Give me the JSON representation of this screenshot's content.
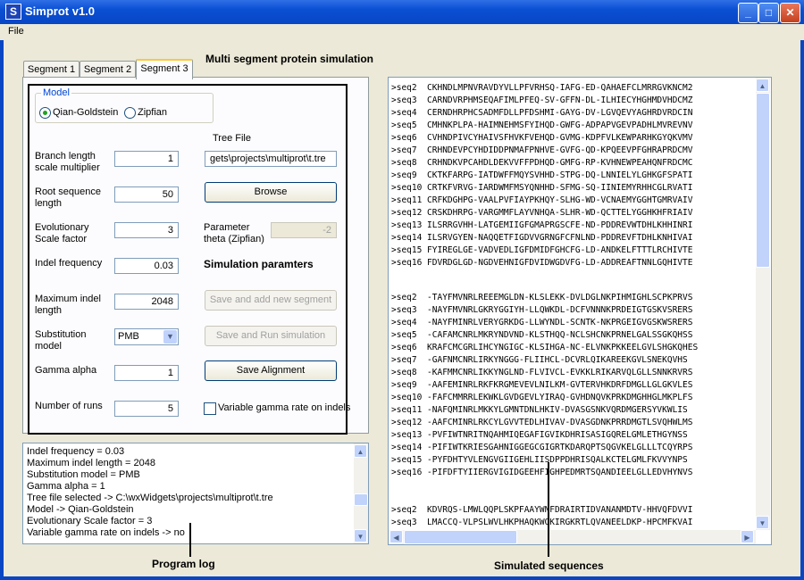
{
  "window": {
    "title": "Simprot v1.0",
    "icon_letter": "S"
  },
  "menu": {
    "file": "File"
  },
  "headings": {
    "main": "Multi segment protein simulation",
    "sim_params": "Simulation paramters",
    "program_log": "Program log",
    "simulated_sequences": "Simulated sequences"
  },
  "tabs": [
    "Segment 1",
    "Segment 2",
    "Segment 3"
  ],
  "model": {
    "legend": "Model",
    "options": [
      "Qian-Goldstein",
      "Zipfian"
    ],
    "selected": "Qian-Goldstein"
  },
  "fields": {
    "branch_length": {
      "label1": "Branch length",
      "label2": "scale multiplier",
      "value": "1"
    },
    "root_seq_length": {
      "label1": "Root sequence",
      "label2": "length",
      "value": "50"
    },
    "evo_scale": {
      "label1": "Evolutionary",
      "label2": "Scale factor",
      "value": "3"
    },
    "indel_freq": {
      "label1": "Indel frequency",
      "value": "0.03"
    },
    "max_indel": {
      "label1": "Maximum indel",
      "label2": "length",
      "value": "2048"
    },
    "substitution": {
      "label1": "Substitution",
      "label2": "model",
      "value": "PMB"
    },
    "gamma_alpha": {
      "label1": "Gamma alpha",
      "value": "1"
    },
    "num_runs": {
      "label1": "Number of runs",
      "value": "5"
    },
    "tree_file": {
      "label": "Tree File",
      "value": "gets\\projects\\multiprot\\t.tre"
    },
    "param_theta": {
      "label1": "Parameter",
      "label2": "theta (Zipfian)",
      "value": "-2"
    }
  },
  "buttons": {
    "browse": "Browse",
    "save_add": "Save and add new segment",
    "save_run": "Save and Run simulation",
    "save_alignment": "Save Alignment"
  },
  "checkbox": {
    "variable_gamma": "Variable gamma rate on indels",
    "checked": false
  },
  "log": [
    "Indel frequency = 0.03",
    "Maximum indel length = 2048",
    "Substitution model = PMB",
    "Gamma alpha = 1",
    "Tree file selected -> C:\\wxWidgets\\projects\\multiprot\\t.tre",
    "Model -> Qian-Goldstein",
    "Evolutionary Scale factor = 3",
    "Variable gamma rate on indels -> no"
  ],
  "sequences": {
    "block1": [
      ">seq2  CKHNDLMPNVRAVDYVLLPFVRHSQ-IAFG-ED-QAHAEFCLMRRGVKNCM2",
      ">seq3  CARNDVRPHMSEQAFIMLPFEQ-SV-GFFN-DL-ILHIECYHGHMDVHDCMZ",
      ">seq4  CERNDHRPHCSADMFDLLPFDSHMI-GAYG-DV-LGVQEVYAGHRDVRDCIN",
      ">seq5  CMHNKPLPA-HAIMNEHMSFYIHQD-GWFG-ADPAPVGEVPADHLMVREVNV",
      ">seq6  CVHNDPIVCYHAIVSFHVKFVEHQD-GVMG-KDPFVLKEWPARHKGYQKVMV",
      ">seq7  CRHNDEVPCYHDIDDPNMAFPNHVE-GVFG-QD-KPQEEVPFGHRAPRDCMV",
      ">seq8  CRHNDKVPCAHDLDEKVVFFPDHQD-GMFG-RP-KVHNEWPEAHQNFRDCMC",
      ">seq9  CKTKFARPG-IATDWFFMQYSVHHD-STPG-DQ-LNNIELYLGHKGFSPATI",
      ">seq10 CRTKFVRVG-IARDWMFMSYQNHHD-SFMG-SQ-IINIEMYRHHCGLRVATI",
      ">seq11 CRFKDGHPG-VAALPVFIAYPKHQY-SLHG-WD-VCNAEMYGGHTGMRVAIV",
      ">seq12 CRSKDHRPG-VARGMMFLAYVNHQA-SLHR-WD-QCTTELYGGHKHFRIAIV",
      ">seq13 ILSRRGVHH-LATGEMIIGFGMAPRGSCFE-ND-PDDREVWTDHLKHHINRI",
      ">seq14 ILSRVGYEN-NAQQETFIGDVVGRNGFCFNLND-PDDREVFTDHLKNHIVAI",
      ">seq15 FYIREGLGE-VADVEDLIGFDMIDFGHCFG-LD-ANDKELFTTTLRCHIVTE",
      ">seq16 FDVRDGLGD-NGDVEHNIGFDVIDWGDVFG-LD-ADDREAFTNNLGQHIVTE"
    ],
    "block2": [
      ">seq2  -TAYFMVNRLREEEMGLDN-KLSLEKK-DVLDGLNKPIHMIGHLSCPKPRVS",
      ">seq3  -NAYFMVNRLGKRYGGIYH-LLQWKDL-DCFVNNNKPRDEIGTGSKVSRERS",
      ">seq4  -NAYFMINRLVERYGRKDG-LLWYNDL-SCNTK-NKPRGEIGVGSKWSRERS",
      ">seq5  -CAFAMCNRLMKRYNDVND-KLSTHQQ-NCLSHCNKPRNELGALSSGKQHSS",
      ">seq6  KRAFCMCGRLIHCYNGIGC-KLSIHGA-NC-ELVNKPKKEELGVLSHGKQHES",
      ">seq7  -GAFNMCNRLIRKYNGGG-FLIIHCL-DCVRLQIKAREEKGVLSNEKQVHS",
      ">seq8  -KAFMMCNRLIKKYNGLND-FLVIVCL-EVKKLRIKARVQLGLLSNNKRVRS",
      ">seq9  -AAFEMINRLRKFKRGMEVEVLNILKM-GVTERVHKDRFDMGLLGLGKVLES",
      ">seq10 -FAFCMMRRLEKWKLGVDGEVLYIRAQ-GVHDNQVKPRKDMGHHGLMKPLFS",
      ">seq11 -NAFQMINRLMKKYLGMNTDNLHKIV-DVASGSNKVQRDMGERSYVKWLIS",
      ">seq12 -AAFCMINRLRKCYLGVVTEDLHIVAV-DVASGDNKPRRDMGTLSVQHWLMS",
      ">seq13 -PVFIWTNRITNQAHMIQEGAFIGVIKDHRISASIGQRELGMLETHGYNSS",
      ">seq14 -PIFIWTKRIESGAHNIGGEGCGIGRTKDARQPTSQGVKELGLLLTCQYRPS",
      ">seq15 -PYFDHTYVLENGVGIIGEHLIISDPPDHRISQALKCTELGMLFKVVYNPS",
      ">seq16 -PIFDFTYIIERGVIGIDGEEHFIGHPEDMRTSQANDIEELGLLEDVHYNVS"
    ],
    "block3": [
      ">seq2  KDVRQS-LMWLQQPLSKPFAAYWNFDRAIRTIDVANANMDTV-HHVQFDVVI",
      ">seq3  LMACCQ-VLPSLWVLHKPHAQKWQKIRGKRTLQVANEELDKP-HPCMFKVAI"
    ]
  },
  "accent_colors": {
    "titlebar": "#0a4fd3",
    "frame": "#0846c4",
    "radio_dot": "#21a121",
    "tab_highlight": "#ffc83c"
  }
}
